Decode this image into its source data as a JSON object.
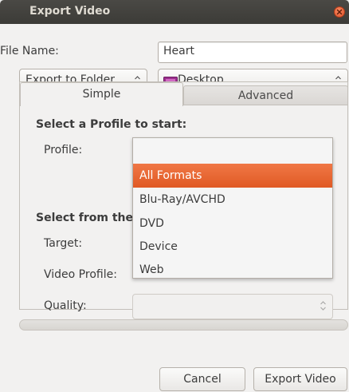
{
  "window": {
    "title": "Export Video"
  },
  "file_name": {
    "label": "File Name:",
    "value": "Heart"
  },
  "export_to": {
    "selected": "Export to Folder",
    "folder": "Desktop"
  },
  "tabs": [
    {
      "label": "Simple",
      "active": true
    },
    {
      "label": "Advanced",
      "active": false
    }
  ],
  "simple": {
    "profile_heading": "Select a Profile to start:",
    "profile_label": "Profile:",
    "select_heading": "Select from the",
    "target_label": "Target:",
    "video_profile_label": "Video Profile:",
    "quality_label": "Quality:",
    "quality_value": ""
  },
  "profile_dropdown": {
    "options": [
      "All Formats",
      "Blu-Ray/AVCHD",
      "DVD",
      "Device",
      "Web"
    ],
    "selected_index": 0
  },
  "buttons": {
    "cancel": "Cancel",
    "export": "Export Video"
  },
  "colors": {
    "accent": "#e8642e",
    "titlebar": "#3c3b37",
    "close": "#e0532b"
  }
}
